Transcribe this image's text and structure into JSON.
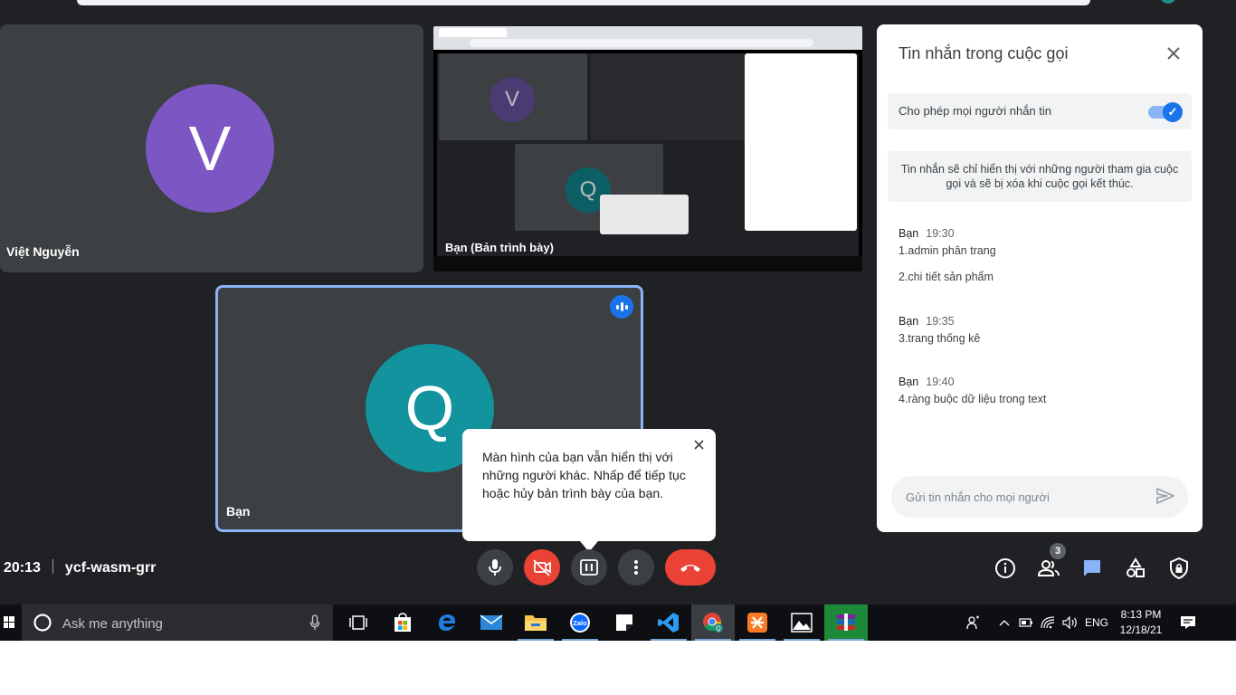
{
  "participants": {
    "tile1": {
      "initial": "V",
      "name": "Việt Nguyễn",
      "avatar_color": "#7c57c4"
    },
    "presentation": {
      "name": "Bạn (Bản trình bày)"
    },
    "self": {
      "initial": "Q",
      "name": "Bạn",
      "avatar_color": "#12939e"
    }
  },
  "chat": {
    "title": "Tin nhắn trong cuộc gọi",
    "allow_label": "Cho phép mọi người nhắn tin",
    "notice": "Tin nhắn sẽ chỉ hiển thị với những người tham gia cuộc gọi và sẽ bị xóa khi cuộc gọi kết thúc.",
    "messages": [
      {
        "sender": "Bạn",
        "time": "19:30",
        "lines": [
          "1.admin phân trang",
          "2.chi tiết sản phẩm"
        ]
      },
      {
        "sender": "Bạn",
        "time": "19:35",
        "lines": [
          "3.trang thống kê"
        ]
      },
      {
        "sender": "Bạn",
        "time": "19:40",
        "lines": [
          "4.ràng buộc dữ liệu trong text"
        ]
      }
    ],
    "input_placeholder": "Gửi tin nhắn cho mọi người"
  },
  "tooltip": {
    "text": "Màn hình của bạn vẫn hiển thị với những người khác. Nhấp để tiếp tục hoặc hủy bản trình bày của bạn."
  },
  "meeting": {
    "time": "20:13",
    "code": "ycf-wasm-grr",
    "people_count": "3"
  },
  "taskbar": {
    "search_placeholder": "Ask me anything",
    "language": "ENG",
    "time": "8:13 PM",
    "date": "12/18/21",
    "apps": [
      "task-view",
      "store",
      "edge",
      "mail",
      "file-explorer",
      "zalo",
      "sticky-notes",
      "vscode",
      "chrome",
      "xampp",
      "photos",
      "winrar"
    ]
  },
  "colors": {
    "meet_bg": "#202124",
    "tile_bg": "#3c4043",
    "accent": "#1a73e8",
    "danger": "#ea4335",
    "chat_icon": "#8ab4f8"
  }
}
